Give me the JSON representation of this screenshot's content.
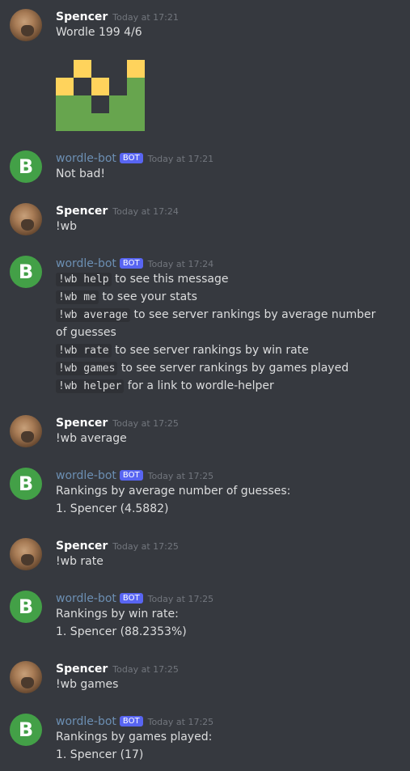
{
  "colors": {
    "background": "#36393f",
    "bot_badge": "#5865f2",
    "bot_avatar": "#43a047",
    "wordle_yellow": "#ffd35c",
    "wordle_green": "#67a54e"
  },
  "messages": [
    {
      "author": "Spencer",
      "time": "Today at 17:21",
      "lines": [
        "Wordle 199 4/6"
      ],
      "wordle_grid": [
        [
          "black",
          "yellow",
          "black",
          "black",
          "yellow"
        ],
        [
          "yellow",
          "black",
          "yellow",
          "black",
          "green"
        ],
        [
          "green",
          "green",
          "black",
          "green",
          "green"
        ],
        [
          "green",
          "green",
          "green",
          "green",
          "green"
        ]
      ]
    },
    {
      "author": "wordle-bot",
      "badge": "BOT",
      "avatar_letter": "B",
      "time": "Today at 17:21",
      "lines": [
        "Not bad!"
      ]
    },
    {
      "author": "Spencer",
      "time": "Today at 17:24",
      "lines": [
        "!wb"
      ]
    },
    {
      "author": "wordle-bot",
      "badge": "BOT",
      "avatar_letter": "B",
      "time": "Today at 17:24",
      "help": [
        {
          "code": "!wb help",
          "text": " to see this message"
        },
        {
          "code": "!wb me",
          "text": " to see your stats"
        },
        {
          "code": "!wb average",
          "text": " to see server rankings by average number",
          "cont": "of guesses"
        },
        {
          "code": "!wb rate",
          "text": " to see server rankings by win rate"
        },
        {
          "code": "!wb games",
          "text": " to see server rankings by games played"
        },
        {
          "code": "!wb helper",
          "text": " for a link to wordle-helper"
        }
      ]
    },
    {
      "author": "Spencer",
      "time": "Today at 17:25",
      "lines": [
        "!wb average"
      ]
    },
    {
      "author": "wordle-bot",
      "badge": "BOT",
      "avatar_letter": "B",
      "time": "Today at 17:25",
      "lines": [
        "Rankings by average number of guesses:",
        "1. Spencer (4.5882)"
      ]
    },
    {
      "author": "Spencer",
      "time": "Today at 17:25",
      "lines": [
        "!wb rate"
      ]
    },
    {
      "author": "wordle-bot",
      "badge": "BOT",
      "avatar_letter": "B",
      "time": "Today at 17:25",
      "lines": [
        "Rankings by win rate:",
        "1. Spencer (88.2353%)"
      ]
    },
    {
      "author": "Spencer",
      "time": "Today at 17:25",
      "lines": [
        "!wb games"
      ]
    },
    {
      "author": "wordle-bot",
      "badge": "BOT",
      "avatar_letter": "B",
      "time": "Today at 17:25",
      "lines": [
        "Rankings by games played:",
        "1. Spencer (17)"
      ]
    }
  ]
}
